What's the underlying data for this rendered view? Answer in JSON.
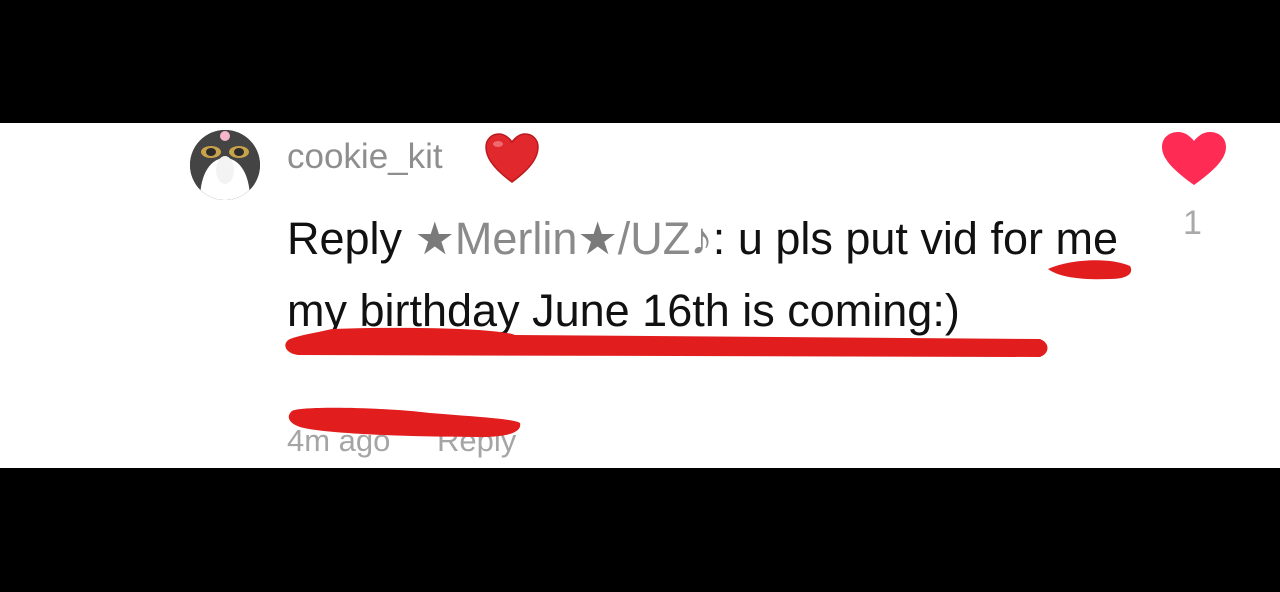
{
  "comment": {
    "username": "cookie_kit",
    "reply_prefix": "Reply",
    "reply_target_star_left": "★",
    "reply_target_name": "Merlin",
    "reply_target_star_right": "★",
    "reply_target_suffix": "/UZ♪",
    "separator": ": ",
    "body": "u pls put vid for me my birthday June 16th is coming:)",
    "timestamp": "4m ago",
    "reply_label": "Reply",
    "like_count": "1"
  },
  "icons": {
    "username_badge": "red-heart-emoji-icon",
    "like": "heart-like-icon",
    "avatar": "cat-avatar"
  },
  "colors": {
    "like_heart": "#fe2c55",
    "annotation_marker": "#e11d1d"
  }
}
